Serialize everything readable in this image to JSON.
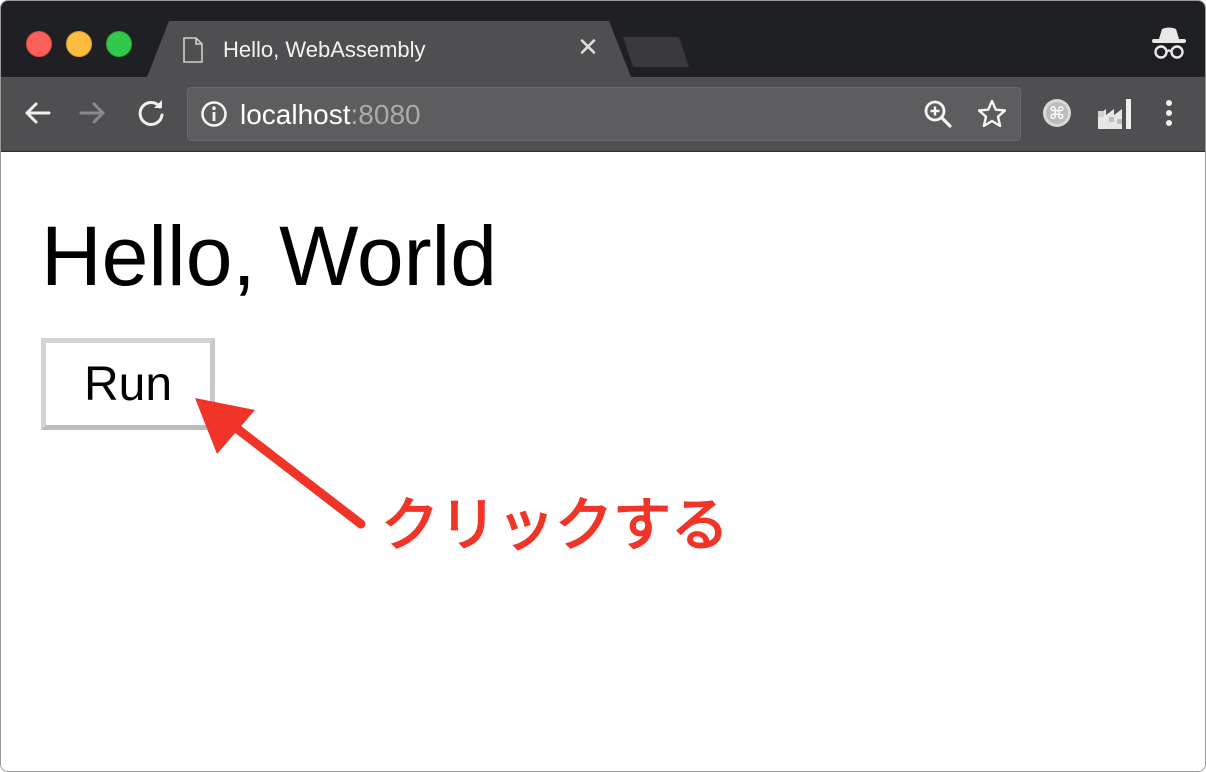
{
  "browser": {
    "tab": {
      "title": "Hello, WebAssembly",
      "close_glyph": "✕"
    },
    "omnibox": {
      "host": "localhost",
      "port": ":8080"
    },
    "icons": {
      "page_icon": "document-icon",
      "incognito": "incognito-icon",
      "back": "back-arrow-icon",
      "forward": "forward-arrow-icon",
      "reload": "reload-icon",
      "info": "info-icon",
      "zoom": "zoom-in-icon",
      "bookmark": "star-icon",
      "extension1": "command-extension-icon",
      "extension2": "factory-extension-icon",
      "menu": "more-vert-icon"
    }
  },
  "page": {
    "heading": "Hello, World",
    "run_button_label": "Run",
    "annotation_text": "クリックする"
  },
  "colors": {
    "annotation_red": "#f03528",
    "tab_background": "#4f4f51",
    "titlebar_background": "#1f2023"
  }
}
